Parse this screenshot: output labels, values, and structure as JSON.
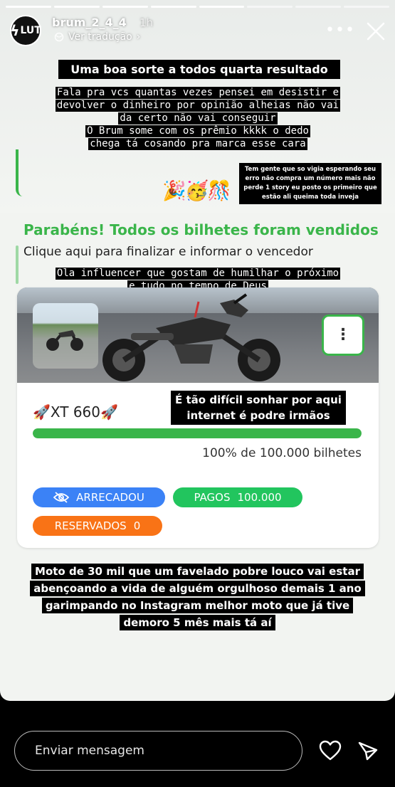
{
  "header": {
    "username": "brum_2_4_4",
    "time": "1h",
    "translate_label": "Ver tradução",
    "translate_chevron": "›",
    "avatar_text": "LUT",
    "more_label": "•••"
  },
  "captions": {
    "title": "Uma boa sorte a todos quarta resultado",
    "mono_lines": [
      "Fala pra vcs quantas vezes pensei em desistir e",
      "devolver o dinheiro por opinião alheias não vai",
      "da certo não vai conseguir",
      "O Brum some com os prêmio kkkk o dedo",
      "chega tá cosando pra marca esse cara"
    ],
    "small_note": "Tem gente que so vigia esperando seu erro não compra um número mais não perde 1 story eu posto os primeiro que estão ali queima toda inveja",
    "emojis": "🎉🥳🎊",
    "influencer_lines": [
      "Ola influencer que gostam de humilhar o próximo",
      "e tudo no tempo de Deus"
    ],
    "dream_lines": [
      "É tão difícil sonhar por aqui",
      "internet é podre irmãos"
    ],
    "bottom_lines": [
      "Moto de 30 mil que um favelado pobre louco vai estar",
      "abençoando a vida de alguém orgulhoso demais 1 ano",
      "garimpando no Instagram melhor moto que já tive",
      "demoro 5 mês mais tá aí"
    ]
  },
  "raffle": {
    "congrats": "Parabéns! Todos os bilhetes foram vendidos",
    "finalize": "Clique aqui para finalizar e informar o vencedor",
    "product_name": "🚀XT 660🚀",
    "progress_fraction": 1.0,
    "progress_text": "100% de 100.000 bilhetes",
    "arrecadou_label": "ARRECADOU",
    "pagos_label": "PAGOS",
    "pagos_value": "100.000",
    "reservados_label": "RESERVADOS",
    "reservados_value": "0",
    "menu_icon": "⋮"
  },
  "reply_bar": {
    "placeholder": "Enviar mensagem"
  },
  "colors": {
    "accent_green": "#3ab54a",
    "blue": "#3b82f6",
    "green": "#22c55e",
    "orange": "#f97316"
  }
}
